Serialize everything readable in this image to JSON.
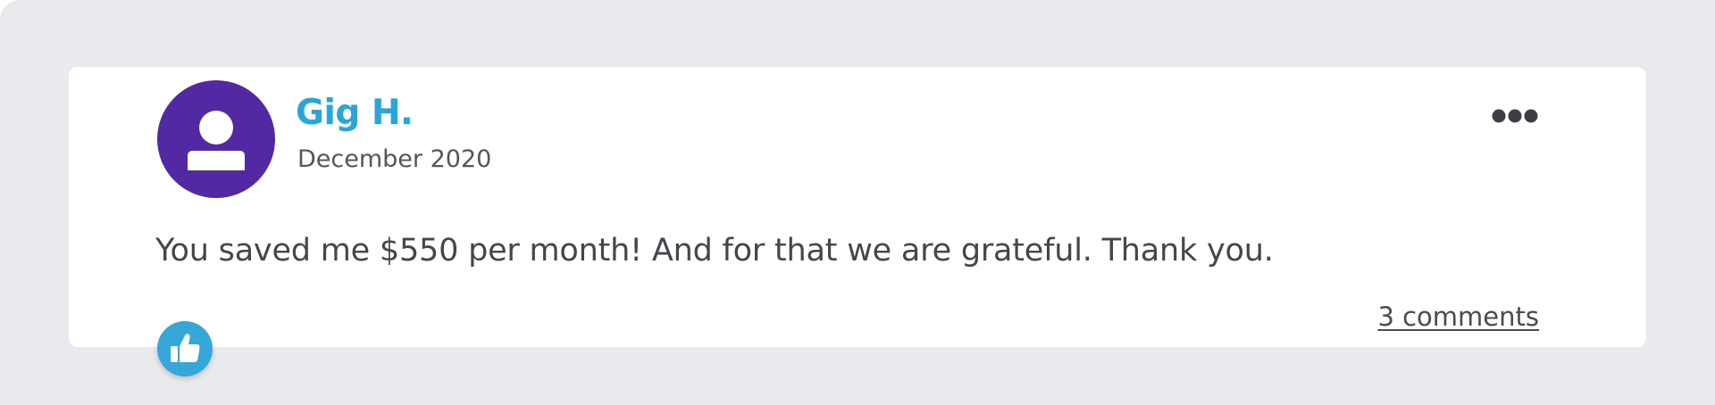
{
  "review": {
    "author_name": "Gig H.",
    "date": "December 2020",
    "text": "You saved me $550 per month! And for that we are grateful. Thank you.",
    "comments_label": "3 comments"
  },
  "icons": {
    "avatar": "user-icon",
    "more": "more-options-icon",
    "like": "thumbs-up-icon"
  },
  "colors": {
    "background": "#e9eaed",
    "card": "#ffffff",
    "avatar_bg": "#5229a3",
    "author_name": "#2aa5d8",
    "text": "#45464b",
    "like_button": "#35a8d9"
  }
}
